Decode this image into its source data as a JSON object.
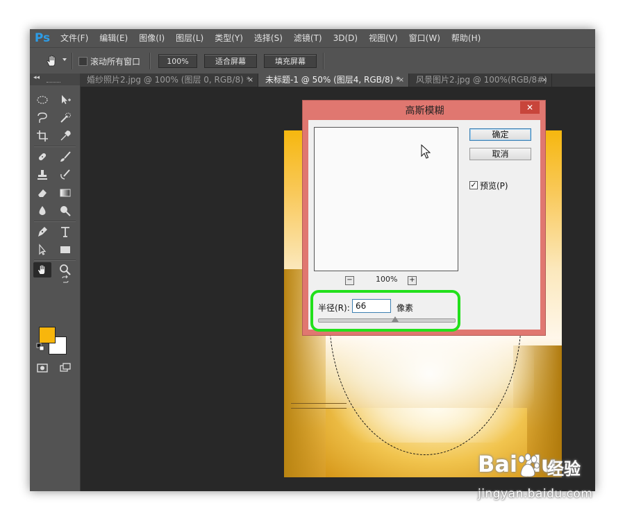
{
  "app": {
    "logo": "Ps"
  },
  "menu": [
    "文件(F)",
    "编辑(E)",
    "图像(I)",
    "图层(L)",
    "类型(Y)",
    "选择(S)",
    "滤镜(T)",
    "3D(D)",
    "视图(V)",
    "窗口(W)",
    "帮助(H)"
  ],
  "options": {
    "scroll_all_label": "滚动所有窗口",
    "scroll_all_checked": false,
    "zoom_100_label": "100%",
    "fit_screen_label": "适合屏幕",
    "fill_screen_label": "填充屏幕"
  },
  "tabs": [
    {
      "label": "婚纱照片2.jpg @ 100% (图层 0, RGB/8) *",
      "close": "×",
      "active": false
    },
    {
      "label": "未标题-1 @ 50% (图层4, RGB/8) *",
      "close": "×",
      "active": true
    },
    {
      "label": "风景图片2.jpg @ 100%(RGB/8#)",
      "close": "×",
      "active": false
    }
  ],
  "toolbox": {
    "collapse_glyph": "◂◂",
    "foreground_color": "#f8b60c",
    "background_color": "#ffffff"
  },
  "dialog": {
    "title": "高斯模糊",
    "close": "✕",
    "ok_label": "确定",
    "cancel_label": "取消",
    "preview_label": "预览(P)",
    "preview_checked": true,
    "check_mark": "✓",
    "zoom_minus": "−",
    "zoom_plus": "+",
    "zoom_level": "100%",
    "radius_label": "半径(R):",
    "radius_value": "66",
    "radius_unit": "像素",
    "highlight_color": "#22e01b"
  },
  "watermark": {
    "brand": "Bai du",
    "site": "经验",
    "url": "jingyan.baidu.com"
  }
}
